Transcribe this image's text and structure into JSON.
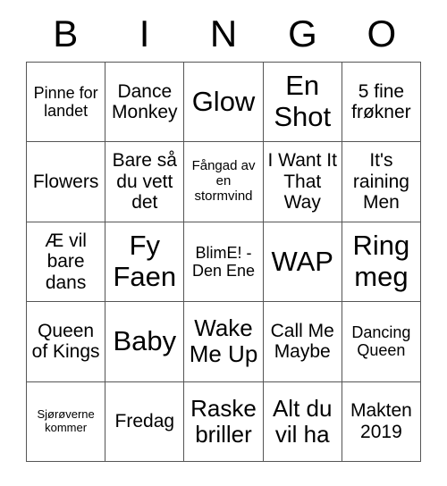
{
  "card": {
    "header_letters": [
      "B",
      "I",
      "N",
      "G",
      "O"
    ],
    "columns": 5,
    "rows": 5,
    "cells": [
      [
        {
          "text": "Pinne for landet",
          "size": "sm"
        },
        {
          "text": "Dance Monkey",
          "size": "md"
        },
        {
          "text": "Glow",
          "size": "xl"
        },
        {
          "text": "En Shot",
          "size": "xl"
        },
        {
          "text": "5 fine frøkner",
          "size": "md"
        }
      ],
      [
        {
          "text": "Flowers",
          "size": "md"
        },
        {
          "text": "Bare så du vett det",
          "size": "md"
        },
        {
          "text": "Fångad av en stormvind",
          "size": "xs"
        },
        {
          "text": "I Want It That Way",
          "size": "md"
        },
        {
          "text": "It's raining Men",
          "size": "md"
        }
      ],
      [
        {
          "text": "Æ vil bare dans",
          "size": "md"
        },
        {
          "text": "Fy Faen",
          "size": "xl"
        },
        {
          "text": "BlimE! - Den Ene",
          "size": "sm"
        },
        {
          "text": "WAP",
          "size": "xl"
        },
        {
          "text": "Ring meg",
          "size": "xl"
        }
      ],
      [
        {
          "text": "Queen of Kings",
          "size": "md"
        },
        {
          "text": "Baby",
          "size": "xl"
        },
        {
          "text": "Wake Me Up",
          "size": "lg"
        },
        {
          "text": "Call Me Maybe",
          "size": "md"
        },
        {
          "text": "Dancing Queen",
          "size": "sm"
        }
      ],
      [
        {
          "text": "Sjørøverne kommer",
          "size": "xxs"
        },
        {
          "text": "Fredag",
          "size": "md"
        },
        {
          "text": "Raske briller",
          "size": "lg"
        },
        {
          "text": "Alt du vil ha",
          "size": "lg"
        },
        {
          "text": "Makten 2019",
          "size": "md"
        }
      ]
    ]
  },
  "colors": {
    "background": "#ffffff",
    "text": "#000000",
    "grid_line": "#555555"
  }
}
